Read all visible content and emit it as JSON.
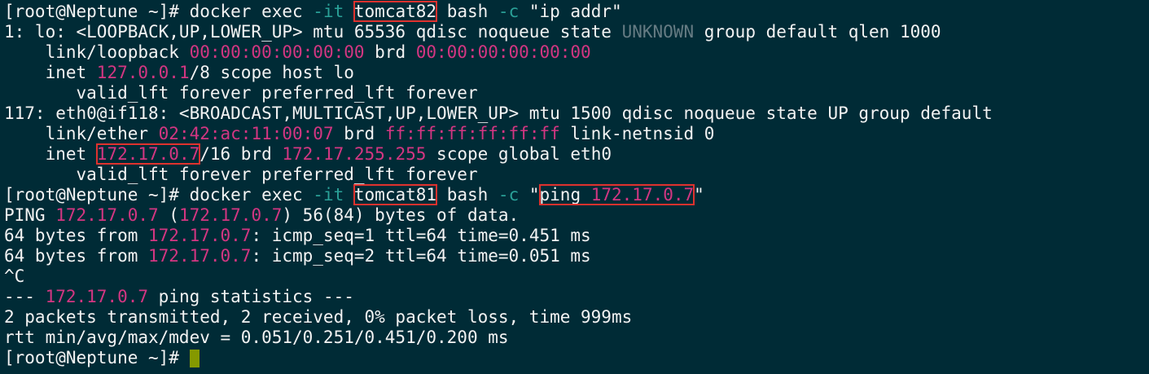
{
  "terminal": {
    "prompt": "[root@Neptune ~]# ",
    "cmd1": {
      "docker": "docker exec ",
      "flag": "-it",
      "container": "tomcat82",
      "bash": "bash ",
      "cflag": "-c",
      "arg": " \"ip addr\""
    },
    "lo": {
      "l1_pre": "1: lo: <LOOPBACK,UP,LOWER_UP> mtu 65536 qdisc noqueue state ",
      "l1_state": "UNKNOWN",
      "l1_post": " group default qlen 1000",
      "l2_pre": "    link/loopback ",
      "l2_mac": "00:00:00:00:00:00",
      "l2_mid": " brd ",
      "l2_brd": "00:00:00:00:00:00",
      "l3_pre": "    inet ",
      "l3_ip": "127.0.0.1",
      "l3_post": "/8 scope host lo",
      "l4": "       valid_lft forever preferred_lft forever"
    },
    "eth0": {
      "l1": "117: eth0@if118: <BROADCAST,MULTICAST,UP,LOWER_UP> mtu 1500 qdisc noqueue state UP group default",
      "l2_pre": "    link/ether ",
      "l2_mac": "02:42:ac:11:00:07",
      "l2_mid": " brd ",
      "l2_brd": "ff:ff:ff:ff:ff:ff",
      "l2_post": " link-netnsid 0",
      "l3_pre": "    inet ",
      "l3_ip": "172.17.0.7",
      "l3_mid": "/16 brd ",
      "l3_brd": "172.17.255.255",
      "l3_post": " scope global eth0",
      "l4": "       valid_lft forever preferred_lft forever"
    },
    "cmd2": {
      "docker": "docker exec ",
      "flag": "-it",
      "container": "tomcat81",
      "bash": "bash ",
      "cflag": "-c",
      "quote_open": " \"",
      "ping": "ping ",
      "ip": "172.17.0.7",
      "quote_close": "\""
    },
    "ping": {
      "l1_pre": "PING ",
      "l1_ip1": "172.17.0.7",
      "l1_mid": " (",
      "l1_ip2": "172.17.0.7",
      "l1_post": ") 56(84) bytes of data.",
      "r1_pre": "64 bytes from ",
      "r1_ip": "172.17.0.7",
      "r1_post": ": icmp_seq=1 ttl=64 time=0.451 ms",
      "r2_pre": "64 bytes from ",
      "r2_ip": "172.17.0.7",
      "r2_post": ": icmp_seq=2 ttl=64 time=0.051 ms",
      "ctrl_c": "^C",
      "stat_pre": "--- ",
      "stat_ip": "172.17.0.7",
      "stat_post": " ping statistics ---",
      "summary": "2 packets transmitted, 2 received, 0% packet loss, time 999ms",
      "rtt": "rtt min/avg/max/mdev = 0.051/0.251/0.451/0.200 ms"
    }
  },
  "colors": {
    "background": "#002b36",
    "foreground": "#f3f3f3",
    "magenta": "#d33682",
    "cyan": "#2aa198",
    "gray": "#657b83",
    "highlight_box": "#e0322e",
    "cursor": "#859900"
  }
}
